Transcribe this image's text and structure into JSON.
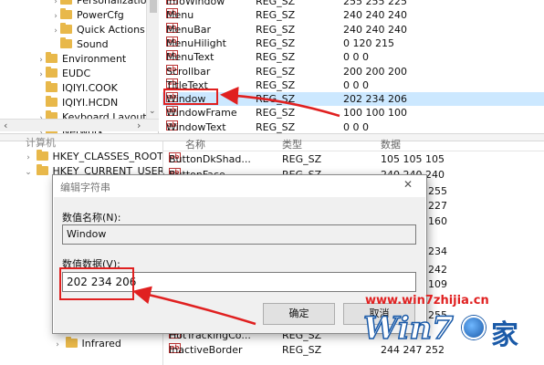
{
  "top_tree": [
    {
      "label": "Personalization",
      "expand": "›"
    },
    {
      "label": "PowerCfg",
      "expand": "›"
    },
    {
      "label": "Quick Actions",
      "expand": "›"
    },
    {
      "label": "Sound",
      "expand": ""
    },
    {
      "label": "Environment",
      "expand": "›"
    },
    {
      "label": "EUDC",
      "expand": "›"
    },
    {
      "label": "IQIYI.COOK",
      "expand": ""
    },
    {
      "label": "IQIYI.HCDN",
      "expand": ""
    },
    {
      "label": "Keyboard Layout",
      "expand": "›"
    },
    {
      "label": "Network",
      "expand": "›"
    }
  ],
  "top_values": [
    {
      "name": "InfoWindow",
      "type": "REG_SZ",
      "data": "255 255 225"
    },
    {
      "name": "Menu",
      "type": "REG_SZ",
      "data": "240 240 240"
    },
    {
      "name": "MenuBar",
      "type": "REG_SZ",
      "data": "240 240 240"
    },
    {
      "name": "MenuHilight",
      "type": "REG_SZ",
      "data": "0 120 215"
    },
    {
      "name": "MenuText",
      "type": "REG_SZ",
      "data": "0 0 0"
    },
    {
      "name": "Scrollbar",
      "type": "REG_SZ",
      "data": "200 200 200"
    },
    {
      "name": "TitleText",
      "type": "REG_SZ",
      "data": "0 0 0"
    },
    {
      "name": "Window",
      "type": "REG_SZ",
      "data": "202 234 206"
    },
    {
      "name": "WindowFrame",
      "type": "REG_SZ",
      "data": "100 100 100"
    },
    {
      "name": "WindowText",
      "type": "REG_SZ",
      "data": "0 0 0"
    }
  ],
  "bottom_tree": {
    "root": "计算机",
    "items": [
      {
        "label": "HKEY_CLASSES_ROOT",
        "expand": "›"
      },
      {
        "label": "HKEY_CURRENT_USER",
        "expand": "⌄"
      }
    ],
    "infrared": "Infrared"
  },
  "bottom_values": {
    "headers": {
      "name": "名称",
      "type": "类型",
      "data": "数据"
    },
    "rows": [
      {
        "name": "ButtonDkShad...",
        "type": "REG_SZ",
        "data": "105 105 105"
      },
      {
        "name": "ButtonFace",
        "type": "REG_SZ",
        "data": "240 240 240"
      }
    ],
    "right_data": [
      "255",
      "227",
      "160",
      "234",
      "242",
      "109",
      "255"
    ],
    "bottom_rows": [
      {
        "name": "HotTrackingCo...",
        "type": "REG_SZ",
        "data": ""
      },
      {
        "name": "InactiveBorder",
        "type": "REG_SZ",
        "data": "244 247 252"
      }
    ]
  },
  "dialog": {
    "title": "编辑字符串",
    "close_glyph": "✕",
    "name_label": "数值名称(N):",
    "name_value": "Window",
    "data_label": "数值数据(V):",
    "data_value": "202 234 206",
    "ok_label": "确定",
    "cancel_label": "取消"
  },
  "watermark": {
    "url": "www.win7zhijia.cn",
    "logo_text": "Win7",
    "logo_suffix": "家"
  },
  "colors": {
    "selection": "#cce8ff",
    "annotation_red": "#e02020",
    "watermark_red": "#e02020",
    "folder": "#e8b84a"
  }
}
